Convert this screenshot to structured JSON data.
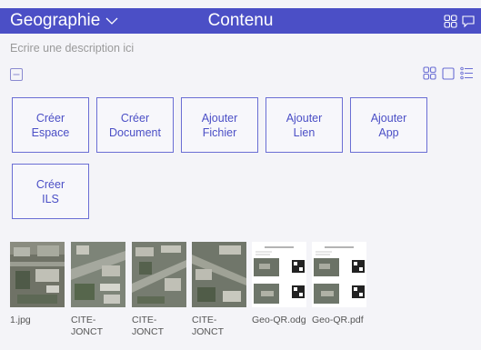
{
  "header": {
    "space_title": "Geographie",
    "section_title": "Contenu",
    "icons": [
      "chevron-down-icon",
      "grid-view-icon",
      "chat-icon"
    ]
  },
  "description_placeholder": "Ecrire une description ici",
  "toolbar": {
    "icons": [
      "collapse-icon",
      "grid-view-icon",
      "single-view-icon",
      "list-view-icon"
    ]
  },
  "actions": [
    {
      "line1": "Créer",
      "line2": "Espace"
    },
    {
      "line1": "Créer",
      "line2": "Document"
    },
    {
      "line1": "Ajouter",
      "line2": "Fichier"
    },
    {
      "line1": "Ajouter",
      "line2": "Lien"
    },
    {
      "line1": "Ajouter",
      "line2": "App"
    },
    {
      "line1": "Créer",
      "line2": "ILS"
    }
  ],
  "files": [
    {
      "name": "1.jpg",
      "kind": "aerial-photo"
    },
    {
      "name": "CITE-JONCT",
      "kind": "aerial-photo"
    },
    {
      "name": "CITE-JONCT",
      "kind": "aerial-photo"
    },
    {
      "name": "CITE-JONCT",
      "kind": "aerial-photo"
    },
    {
      "name": "Geo-QR.odg",
      "kind": "document-page"
    },
    {
      "name": "Geo-QR.pdf",
      "kind": "document-page"
    }
  ],
  "colors": {
    "accent": "#4b4fc6",
    "background": "#f4f4f8",
    "button_border": "#6a6ed4"
  }
}
